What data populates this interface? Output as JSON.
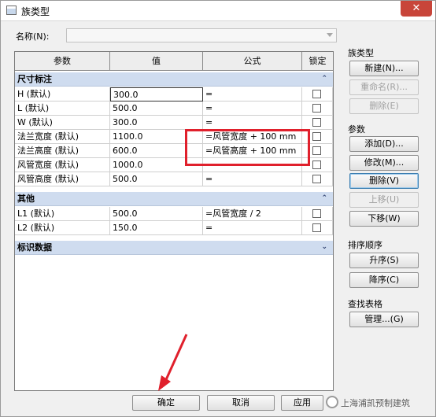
{
  "window": {
    "title": "族类型",
    "close_label": "✕"
  },
  "name_field": {
    "label": "名称(N):",
    "value": ""
  },
  "grid": {
    "headers": {
      "param": "参数",
      "value": "值",
      "formula": "公式",
      "lock": "锁定"
    },
    "categories": [
      {
        "label": "尺寸标注",
        "chevron": "⌃",
        "rows": [
          {
            "name": "H (默认)",
            "value": "300.0",
            "formula": "=",
            "locked": false
          },
          {
            "name": "L (默认)",
            "value": "500.0",
            "formula": "=",
            "locked": false
          },
          {
            "name": "W (默认)",
            "value": "300.0",
            "formula": "=",
            "locked": false
          },
          {
            "name": "法兰宽度 (默认)",
            "value": "1100.0",
            "formula": "=风管宽度 + 100 mm",
            "locked": false
          },
          {
            "name": "法兰高度 (默认)",
            "value": "600.0",
            "formula": "=风管高度 + 100 mm",
            "locked": false
          },
          {
            "name": "风管宽度 (默认)",
            "value": "1000.0",
            "formula": "=",
            "locked": false
          },
          {
            "name": "风管高度 (默认)",
            "value": "500.0",
            "formula": "=",
            "locked": false
          }
        ]
      },
      {
        "label": "其他",
        "chevron": "⌃",
        "rows": [
          {
            "name": "L1 (默认)",
            "value": "500.0",
            "formula": "=风管宽度 / 2",
            "locked": false
          },
          {
            "name": "L2 (默认)",
            "value": "150.0",
            "formula": "=",
            "locked": false
          }
        ]
      },
      {
        "label": "标识数据",
        "chevron": "⌄",
        "rows": []
      }
    ]
  },
  "family_types": {
    "label": "族类型",
    "new": "新建(N)...",
    "rename": "重命名(R)...",
    "delete": "删除(E)"
  },
  "parameters": {
    "label": "参数",
    "add": "添加(D)...",
    "modify": "修改(M)...",
    "remove": "删除(V)",
    "move_up": "上移(U)",
    "move_down": "下移(W)"
  },
  "sort": {
    "label": "排序顺序",
    "ascending": "升序(S)",
    "descending": "降序(C)"
  },
  "lookup": {
    "label": "查找表格",
    "manage": "管理...(G)"
  },
  "footer": {
    "ok": "确定",
    "cancel": "取消",
    "apply": "应用"
  },
  "watermark": {
    "text": "上海浦凯预制建筑"
  },
  "colors": {
    "highlight": "#e0202c",
    "category_bg": "#cfdcef",
    "close": "#c8453a"
  }
}
